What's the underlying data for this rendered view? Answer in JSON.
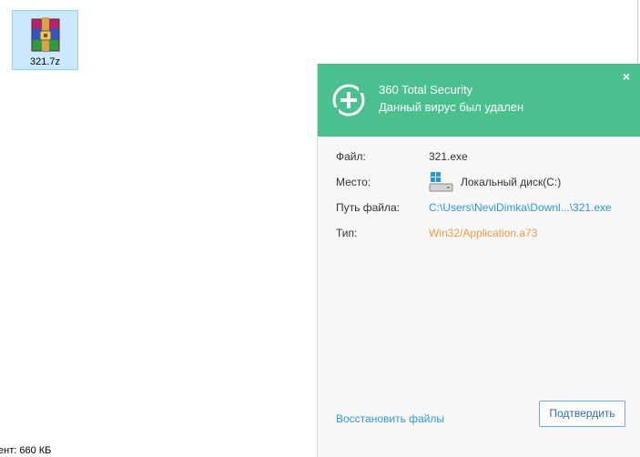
{
  "explorer": {
    "file_name": "321.7z",
    "status_text": "ент: 660 КБ"
  },
  "popup": {
    "app_title": "360 Total Security",
    "subtitle": "Данный вирус был удален",
    "close_symbol": "×",
    "details": {
      "file_label": "Файл:",
      "file_value": "321.exe",
      "location_label": "Место:",
      "location_value": "Локальный диск(C:)",
      "path_label": "Путь файла:",
      "path_value": "C:\\Users\\NeviDimka\\Downl...\\321.exe",
      "type_label": "Тип:",
      "type_value": "Win32/Application.a73"
    },
    "restore_link": "Восстановить файлы",
    "confirm_button": "Подтвердить"
  },
  "colors": {
    "header_green": "#4ac08f",
    "link_blue": "#2b9bdc",
    "type_orange": "#ef9a45",
    "selection_blue": "#cce8ff"
  },
  "icons": {
    "archive": "winrar-archive-icon",
    "logo": "360-plus-logo-icon",
    "drive": "windows-drive-icon"
  }
}
